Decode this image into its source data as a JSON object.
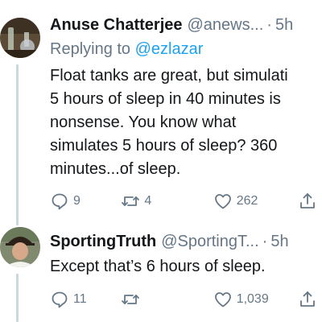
{
  "tweets": [
    {
      "author_name": "Anuse Chatterjee",
      "author_handle": "@anews...",
      "separator": "·",
      "time": "5h",
      "replying_prefix": "Replying to",
      "replying_to": "@ezlazar",
      "text": "Float tanks are great, but simulati\n5 hours of sleep in 40 minutes is\nnonsense. You know what\nsimulates 5 hours of sleep? 360\nminutes...of sleep.",
      "reply_count": "9",
      "retweet_count": "4",
      "like_count": "262",
      "icons": [
        "reply-icon",
        "retweet-icon",
        "like-icon",
        "share-icon"
      ]
    },
    {
      "author_name": "SportingTruth",
      "author_handle": "@SportingT...",
      "separator": "·",
      "time": "5h",
      "text": "Except that’s 6 hours of sleep.",
      "reply_count": "11",
      "retweet_count": "",
      "like_count": "1,039",
      "icons": [
        "reply-icon",
        "retweet-icon",
        "like-icon",
        "share-icon"
      ]
    }
  ],
  "colors": {
    "text": "#14171a",
    "secondary": "#657786",
    "link": "#1da1f2",
    "thread_line": "#ccd6dd"
  }
}
